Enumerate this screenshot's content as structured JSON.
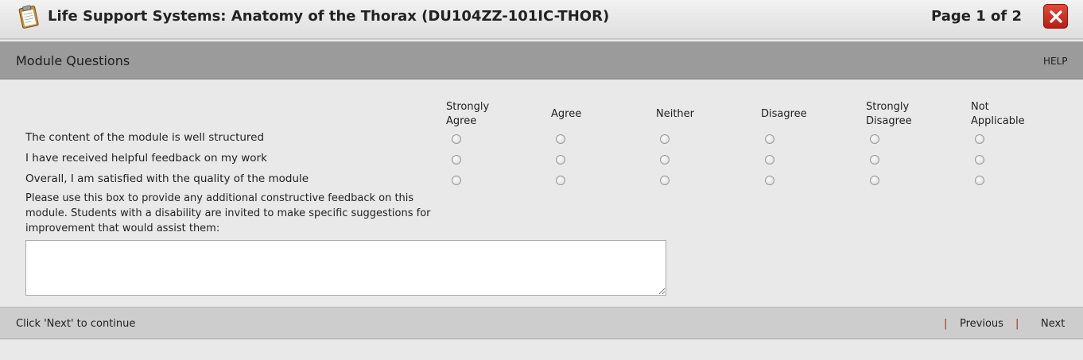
{
  "header": {
    "title": "Life Support Systems: Anatomy of the Thorax (DU104ZZ-101IC-THOR)",
    "page_indicator": "Page 1 of 2",
    "icon": "clipboard-icon",
    "close_icon": "close-icon"
  },
  "section": {
    "title": "Module Questions",
    "help_label": "HELP"
  },
  "scale": {
    "columns": [
      {
        "line1": "Strongly",
        "line2": "Agree"
      },
      {
        "line1": "Agree",
        "line2": ""
      },
      {
        "line1": "Neither",
        "line2": ""
      },
      {
        "line1": "Disagree",
        "line2": ""
      },
      {
        "line1": "Strongly",
        "line2": "Disagree"
      },
      {
        "line1": "Not",
        "line2": "Applicable"
      }
    ]
  },
  "questions": [
    {
      "text": "The content of the module is well structured"
    },
    {
      "text": "I have received helpful feedback on my work"
    },
    {
      "text": "Overall, I am satisfied with the quality of the module"
    }
  ],
  "feedback": {
    "prompt": "Please use this box to provide any additional constructive feedback on this module. Students with a disability are invited to make specific suggestions for improvement that would assist them:",
    "value": ""
  },
  "footer": {
    "instruction": "Click 'Next' to continue",
    "separator": "|",
    "previous_label": "Previous",
    "next_label": "Next"
  },
  "colors": {
    "close_button": "#c8291d",
    "section_bar": "#9b9b9b",
    "footer_bar": "#cdcdcd",
    "separator": "#b02a17"
  }
}
